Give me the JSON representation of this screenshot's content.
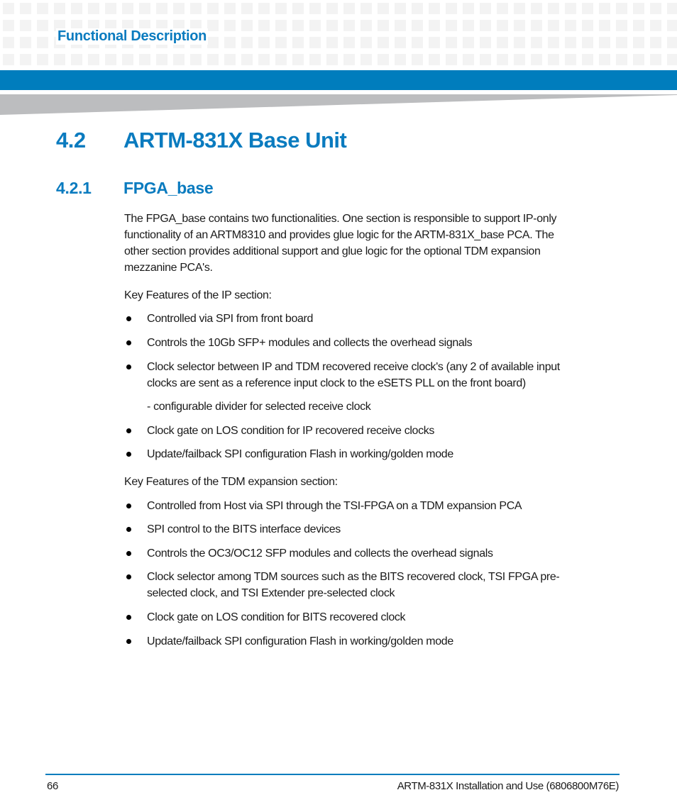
{
  "header": {
    "chapter_title": "Functional Description",
    "accent_color": "#007dbd",
    "heading_color": "#0a7bbf"
  },
  "section": {
    "number": "4.2",
    "title": "ARTM-831X Base Unit"
  },
  "subsection": {
    "number": "4.2.1",
    "title": "FPGA_base"
  },
  "intro_lines": [
    "The FPGA_base contains two functionalities. One section is responsible to support IP-only",
    "functionality of an ARTM8310 and provides glue logic for the ARTM-831X_base PCA. The",
    "other section provides additional support and glue logic for the optional TDM expansion",
    "mezzanine PCA's."
  ],
  "ip_section": {
    "label": "Key Features of the IP section:",
    "bullets": [
      "Controlled via SPI from front board",
      "Controls the 10Gb SFP+ modules and collects the overhead signals",
      "Clock selector between IP and TDM recovered receive clock's (any 2 of available input\nclocks are sent as a reference input clock to the eSETS PLL on the front board)",
      "Clock gate on LOS condition for IP recovered receive clocks",
      " Update/failback SPI configuration Flash in working/golden mode"
    ],
    "sub_note": "- configurable divider for selected receive clock"
  },
  "tdm_section": {
    "label": "Key Features of the TDM expansion section:",
    "bullets": [
      "Controlled from Host via SPI through the TSI-FPGA on a TDM expansion PCA",
      " SPI control to the BITS interface devices",
      "Controls the OC3/OC12 SFP modules and collects the overhead signals",
      "Clock selector among TDM sources such as the BITS recovered clock, TSI FPGA pre-\nselected clock, and TSI Extender pre-selected clock",
      "Clock gate on LOS condition for BITS recovered clock",
      "Update/failback SPI configuration Flash in working/golden mode"
    ]
  },
  "footer": {
    "page_number": "66",
    "doc_title": "ARTM-831X Installation and Use (6806800M76E)"
  }
}
